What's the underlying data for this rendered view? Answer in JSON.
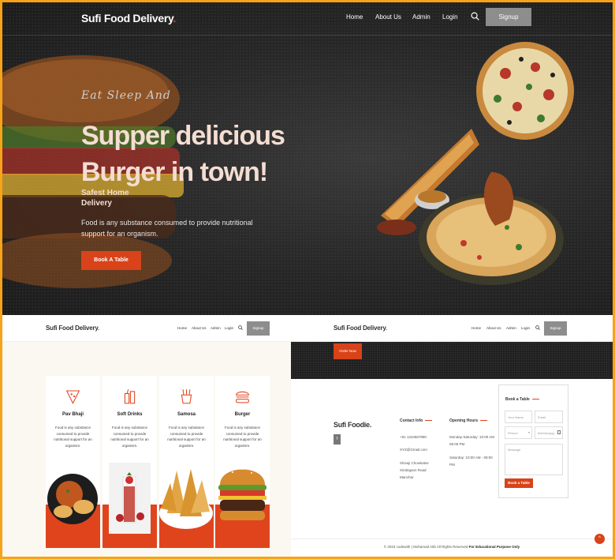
{
  "hero": {
    "brand": "Sufi Food Delivery",
    "brand_dot": ".",
    "nav": [
      "Home",
      "About Us",
      "Admin",
      "Login"
    ],
    "signup": "Signup",
    "eyebrow": "Eat Sleep And",
    "headline_1": "Supper delicious",
    "headline_2": "Burger in town!",
    "subhead_1": "Safest Home",
    "subhead_2": "Delivery",
    "lead": "Food is any substance consumed to provide nutritional support for an organism.",
    "book_btn": "Book A Table"
  },
  "menu_page": {
    "brand": "Sufi Food Delivery",
    "brand_dot": ".",
    "nav": [
      "Home",
      "About Us",
      "Admin",
      "Login"
    ],
    "signup": "Signup",
    "cards": [
      {
        "title": "Pav Bhaji",
        "text": "Food is any substance consumed to provide nutritional support for an organism.",
        "icon": "pizza-slice-icon"
      },
      {
        "title": "Soft Drinks",
        "text": "Food is any substance consumed to provide nutritional support for an organism.",
        "icon": "drinks-icon"
      },
      {
        "title": "Samosa",
        "text": "Food is any substance consumed to provide nutritional support for an organism.",
        "icon": "fries-icon"
      },
      {
        "title": "Burger",
        "text": "Food is any substance consumed to provide nutritional support for an organism.",
        "icon": "burger-icon"
      }
    ]
  },
  "footer_page": {
    "brand": "Sufi Food Delivery",
    "brand_dot": ".",
    "nav": [
      "Home",
      "About Us",
      "Admin",
      "Login"
    ],
    "signup": "Signup",
    "order_btn": "Order Now",
    "foodie": "Sufi Foodie.",
    "fb": "f",
    "contact_title": "Contact Info",
    "contact": [
      "+91 1234567890",
      "XYZ@Gmail.com",
      "Shivaji Chowkatse",
      "Sindegaon Road",
      "Manchar"
    ],
    "hours_title": "Opening Hours",
    "hours": [
      "Monday-Saturday: 10:00 AM",
      "06:00 PM",
      "Saturday: 10:00 AM - 08:00",
      "PM"
    ],
    "form_title": "Book a Table",
    "placeholders": {
      "name": "Your Name",
      "email": "Email",
      "person": "Person",
      "date": "dd/mm/yyyy",
      "message": "Message"
    },
    "form_btn": "Book a Table",
    "copy_prefix": "© 2023 codewith | Mohamad Atib All Rights Reserved",
    "copy_bold": "For Educational Purpose Only",
    "totop": "^"
  },
  "colors": {
    "accent": "#d8431a",
    "frame": "#f6a31a",
    "signup_gray": "#8d8d8d"
  }
}
